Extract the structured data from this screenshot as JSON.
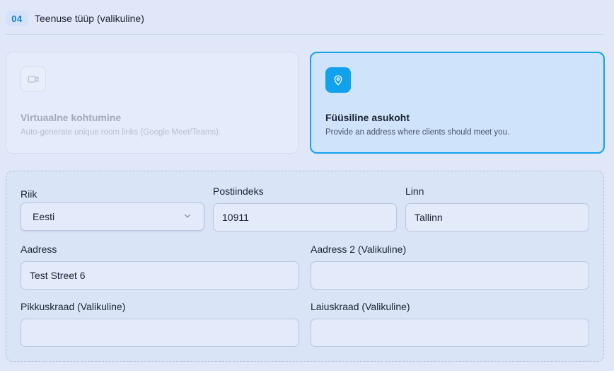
{
  "section": {
    "step": "04",
    "title": "Teenuse tüüp (valikuline)"
  },
  "options": {
    "virtual": {
      "title": "Virtuaalne kohtumine",
      "description": "Auto-generate unique room links (Google Meet/Teams).",
      "icon": "video-camera-icon",
      "state": "disabled"
    },
    "physical": {
      "title": "Füüsiline asukoht",
      "description": "Provide an address where clients should meet you.",
      "icon": "map-pin-icon",
      "state": "selected"
    }
  },
  "address": {
    "country": {
      "label": "Riik",
      "value": "Eesti"
    },
    "postal": {
      "label": "Postiindeks",
      "value": "10911"
    },
    "city": {
      "label": "Linn",
      "value": "Tallinn"
    },
    "address1": {
      "label": "Aadress",
      "value": "Test Street 6"
    },
    "address2": {
      "label": "Aadress 2 (Valikuline)",
      "value": ""
    },
    "latitude": {
      "label": "Pikkuskraad (Valikuline)",
      "value": ""
    },
    "longitude": {
      "label": "Laiuskraad (Valikuline)",
      "value": ""
    }
  },
  "colors": {
    "accent": "#10a2ec",
    "selected_card_bg": "#cfe4fb",
    "page_bg": "#dfe7f8"
  }
}
